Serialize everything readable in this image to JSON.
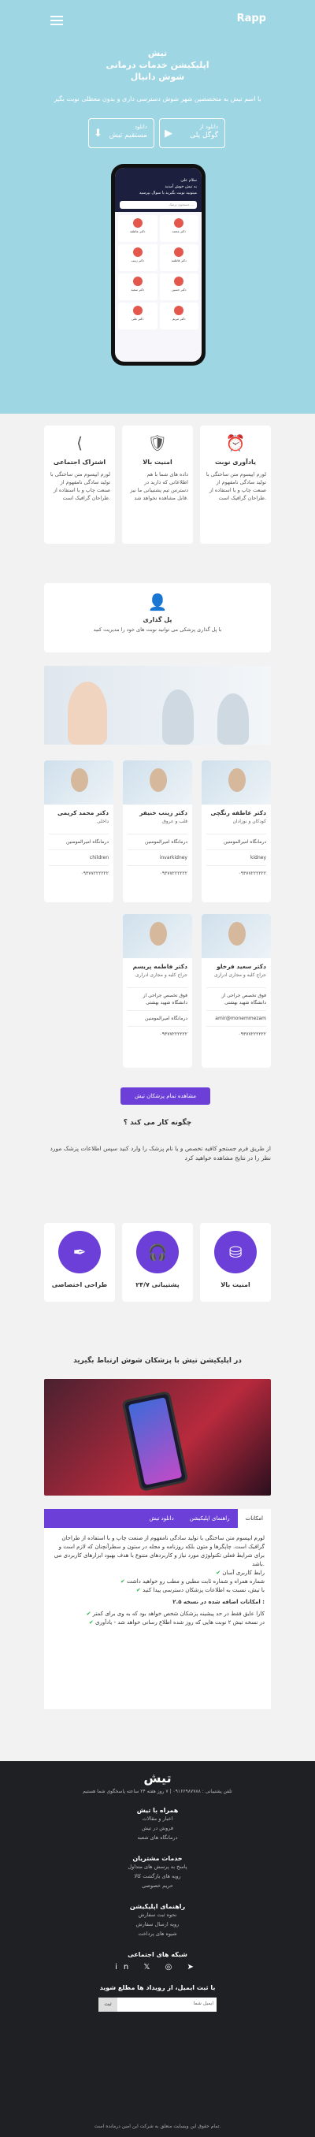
{
  "header": {
    "logo": "Rapp"
  },
  "hero": {
    "title": "تیش\nاپلیکیشن خدمات درمانی\nشوش دانیال",
    "subtitle": "با اسم تیش به متخصصین شهر شوش دسترسی داری و بدون معطلی نوبت بگیر",
    "buttons": [
      {
        "small": "دانلود از",
        "big": "گوگل پلی"
      },
      {
        "small": "دانلود",
        "big": "مستقیم تیش"
      }
    ],
    "phone": {
      "header": "سلام علی\nبه تیش خوش آمدید\nمیتونید نوبت بگیرید یا سوال بپرسید",
      "search": "جستجوی پزشک ...",
      "cards": [
        "دکتر عاطفه",
        "دکتر محمد",
        "دکتر زینب",
        "دکتر فاطمه",
        "دکتر سعید",
        "دکتر حسین",
        "دکتر علی",
        "دکتر مریم"
      ]
    }
  },
  "features": [
    {
      "title": "یادآوری نوبت",
      "text": "لورم ایپسوم متن ساختگی با تولید سادگی نامفهوم از صنعت چاپ و با استفاده از طراحان گرافیک است."
    },
    {
      "title": "امنیت بالا",
      "text": "داده های شما با هم اطلاعاتی که دارید در دسترس تیم پشتیبانی ما نیز قابل مشاهده نخواهد شد."
    },
    {
      "title": "اشتراک اجتماعی",
      "text": "لورم ایپسوم متن ساختگی با تولید سادگی نامفهوم از صنعت چاپ و با استفاده از طراحان گرافیک است."
    }
  ],
  "wide_feature": {
    "title": "پل گذاری",
    "text": "با پل گذاری پزشکی می توانید نوبت های خود را مدیریت کنید"
  },
  "doctors": [
    {
      "name": "دکتر عاطفه رنگچی",
      "spec": "کودکان و نوزادان",
      "clinic": "درمانگاه امیرالمومنین",
      "user": "kidney",
      "phone": "۰۹۳۷۷۲۲۲۲۲۲"
    },
    {
      "name": "دکتر زینب خنیفر",
      "spec": "قلب و عروق",
      "clinic": "درمانگاه امیرالمومنین",
      "user": "invarkidney",
      "phone": "۰۹۳۷۷۲۲۲۲۲۲"
    },
    {
      "name": "دکتر محمد کریمی",
      "spec": "داخلی",
      "clinic": "درمانگاه امیرالمومنین",
      "user": "children",
      "phone": "۰۹۳۷۷۲۲۲۲۲۲"
    },
    {
      "name": "دکتر سعید فرخلو",
      "spec": "جراح کلیه و مجاری ادراری",
      "clinic": "فوق تخصص جراحی از دانشگاه شهید بهشتی",
      "user": "amir@monemmezam",
      "phone": "۰۹۳۷۷۲۲۲۲۲۲"
    },
    {
      "name": "دکتر فاطمه پریسم",
      "spec": "جراح کلیه و مجاری ادراری",
      "clinic": "فوق تخصص جراحی از دانشگاه شهید بهشتی",
      "user": "درمانگاه امیرالمومنین",
      "phone": "۰۹۳۷۷۲۲۲۲۲۲"
    }
  ],
  "all_doctors_button": "مشاهده تمام پزشکان تیش",
  "how": {
    "title": "چگونه کار می کند ؟",
    "text": "از طریق فرم جستجو کافیه تخصص و یا نام پزشک را وارد کنید سپس اطلاعات پزشک مورد نظر را در نتایج مشاهده خواهید کرد",
    "items": [
      {
        "title": "امنیت بالا",
        "icon": "database-icon"
      },
      {
        "title": "پشتیبانی ۲۴/۷",
        "icon": "headset-icon"
      },
      {
        "title": "طراحی اختصاصی",
        "icon": "pen-icon"
      }
    ]
  },
  "app_section": {
    "title": "در اپلیکیشن تیش با پزشکان شوش ارتباط بگیرید",
    "tabs": [
      "امکانات",
      "راهنمای اپلیکیشن",
      "دانلود تیش"
    ],
    "body_intro": "لورم ایپسوم متن ساختگی با تولید سادگی نامفهوم از صنعت چاپ و با استفاده از طراحان گرافیک است. چاپگرها و متون بلکه روزنامه و مجله در ستون و سطرآنچنان که لازم است و برای شرایط فعلی تکنولوژی مورد نیاز و کاربردهای متنوع با هدف بهبود ابزارهای کاربردی می باشد.",
    "checks": [
      "رابط کاربری آسان",
      "شماره همراه و شماره ثابت مطبی و مطب رو خواهید داشت",
      "با تیش، نسبت به اطلاعات پزشکان دسترسی پیدا کنید"
    ],
    "version_title": "امکانات اضافه شده در نسخه ۲.۵ :",
    "version_checks": [
      "کارا عایق فقط در حد پیشینه پزشکان شخص خواهد بود که به وی برای کمتر",
      "در نسخه تیش ۲ نوبت هایی که روز شده اطلاع رسانی خواهد شد - یادآوری"
    ]
  },
  "footer": {
    "logo": "تیش",
    "contact": "تلفن پشتیبانی : ۰۹۱۶۶۹۸۷۷۸۸ | ۷ روز هفته ۲۴ ساعته پاسخگوی شما هستیم",
    "sections": [
      {
        "title": "همراه با تیش",
        "links": [
          "اخبار و مقالات",
          "فروش در تیش",
          "درمانگاه های شعبه"
        ]
      },
      {
        "title": "خدمات مشتریان",
        "links": [
          "پاسخ به پرسش های متداول",
          "رویه های بازگشت کالا",
          "حریم خصوصی"
        ]
      },
      {
        "title": "راهنمای اپلیکیشن",
        "links": [
          "نحوه ثبت سفارش",
          "رویه ارسال سفارش",
          "شیوه های پرداخت"
        ]
      }
    ],
    "social_title": "شبکه های اجتماعی",
    "newsletter_title": "با ثبت ایمیل، از رویداد ها مطلع شوید",
    "email_placeholder": "ایمیل شما",
    "send": "ثبت",
    "copyright": "تمام حقوق این وبسایت متعلق به شرکت این امین درمانده است."
  }
}
